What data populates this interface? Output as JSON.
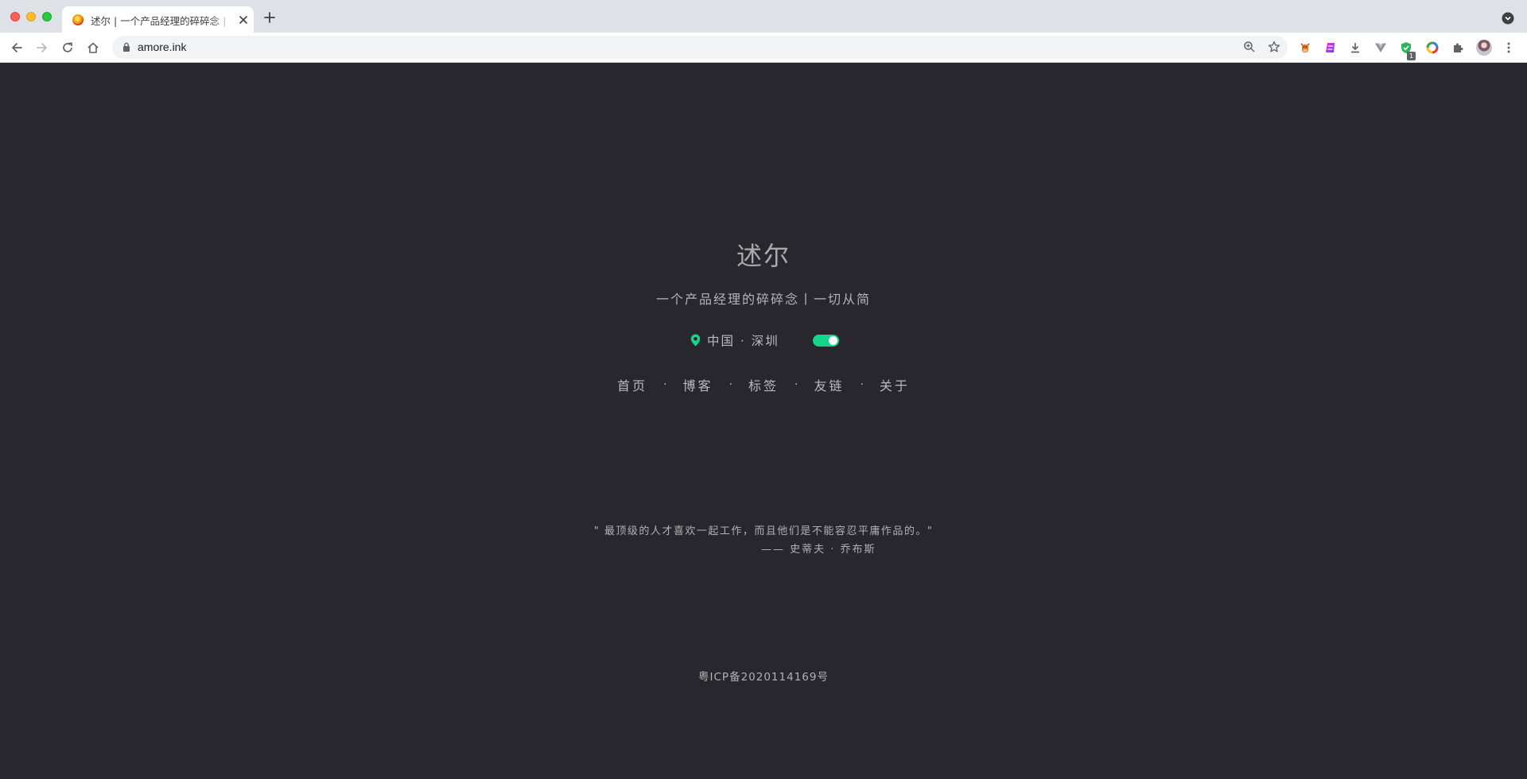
{
  "browser": {
    "tab": {
      "title": "述尔 | 一个产品经理的碎碎念 | 一切从简"
    },
    "omnibox": {
      "url": "amore.ink"
    },
    "extensions": {
      "badge_count": "1"
    }
  },
  "page": {
    "site_title": "述尔",
    "tagline": "一个产品经理的碎碎念丨一切从简",
    "location": "中国 · 深圳",
    "theme_toggle_on": true,
    "nav": {
      "home": "首页",
      "blog": "博客",
      "tags": "标签",
      "links": "友链",
      "about": "关于",
      "separator": "·"
    },
    "quote": {
      "text": "\" 最顶级的人才喜欢一起工作，而且他们是不能容忍平庸作品的。\"",
      "author": "—— 史蒂夫 · 乔布斯"
    },
    "icp": "粤ICP备2020114169号"
  },
  "colors": {
    "page_background": "#28272d",
    "accent_green": "#15d58a",
    "text_gray": "#b3b3b8"
  }
}
